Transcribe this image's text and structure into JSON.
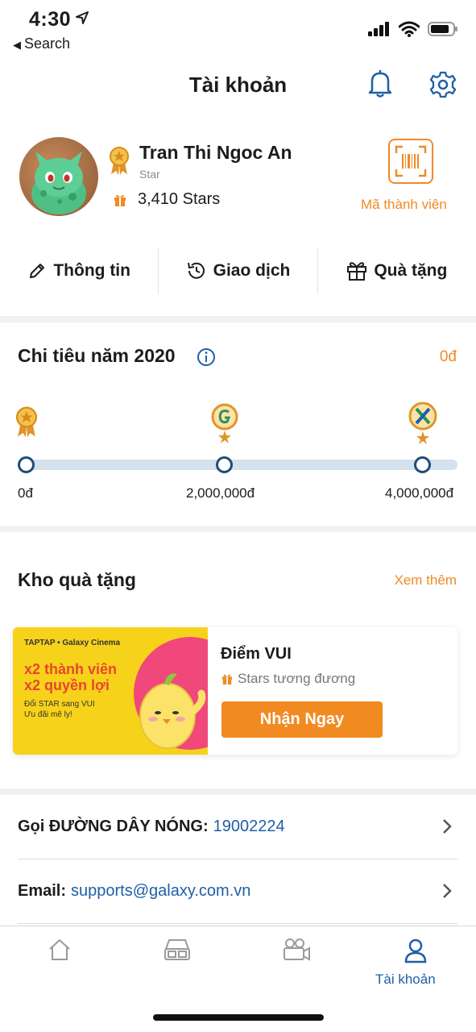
{
  "status": {
    "time": "4:30",
    "back_label": "Search"
  },
  "header": {
    "title": "Tài khoản"
  },
  "profile": {
    "name": "Tran Thi Ngoc An",
    "tier": "Star",
    "stars": "3,410 Stars",
    "member_code_label": "Mã thành viên"
  },
  "tabs": [
    {
      "label": "Thông tin",
      "icon": "pencil-icon"
    },
    {
      "label": "Giao dịch",
      "icon": "history-icon"
    },
    {
      "label": "Quà tặng",
      "icon": "gift-icon"
    }
  ],
  "spending": {
    "title": "Chi tiêu năm 2020",
    "value": "0đ",
    "levels": [
      {
        "label": "0đ",
        "icon": "star-medal-icon"
      },
      {
        "label": "2,000,000đ",
        "icon": "g-medal-icon"
      },
      {
        "label": "4,000,000đ",
        "icon": "x-medal-icon"
      }
    ]
  },
  "gifts": {
    "title": "Kho quà tặng",
    "see_more": "Xem thêm",
    "card": {
      "banner_brand": "TAPTAP • Galaxy Cinema",
      "banner_line1": "x2 thành viên",
      "banner_line2": "x2 quyền lợi",
      "banner_small1": "Đổi STAR sang VUI",
      "banner_small2": "Ưu đãi mê ly!",
      "name": "Điểm VUI",
      "subtitle": "Stars tương đương",
      "button": "Nhận Ngay"
    }
  },
  "contact": {
    "hotline_label": "Gọi ĐƯỜNG DÂY NÓNG:",
    "hotline_value": "19002224",
    "email_label": "Email:",
    "email_value": "supports@galaxy.com.vn"
  },
  "nav": {
    "items": [
      {
        "icon": "home-icon"
      },
      {
        "icon": "cinema-glasses-icon"
      },
      {
        "icon": "camera-icon"
      },
      {
        "icon": "user-icon",
        "label": "Tài khoản",
        "active": true
      }
    ]
  },
  "colors": {
    "accent": "#f08a24",
    "primary": "#1f4c7a",
    "link": "#1f5fa6"
  }
}
